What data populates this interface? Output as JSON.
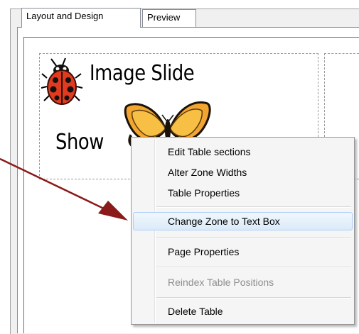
{
  "tabs": [
    {
      "label": "Layout and Design",
      "active": true
    },
    {
      "label": "Preview",
      "active": false
    }
  ],
  "banner": {
    "line1": "Image Slide",
    "line2": "Show",
    "images": [
      "ladybug",
      "butterfly"
    ]
  },
  "context_menu": {
    "items": [
      {
        "label": "Edit Table sections",
        "enabled": true
      },
      {
        "label": "Alter Zone Widths",
        "enabled": true
      },
      {
        "label": "Table Properties",
        "enabled": true
      },
      {
        "label": "Change Zone to Text Box",
        "enabled": true,
        "highlighted": true
      },
      {
        "label": "Page Properties",
        "enabled": true
      },
      {
        "label": "Reindex Table Positions",
        "enabled": false
      },
      {
        "label": "Delete Table",
        "enabled": true
      }
    ]
  },
  "colors": {
    "arrow": "#8b1a1a",
    "menu_highlight": "#dbeaf8"
  }
}
